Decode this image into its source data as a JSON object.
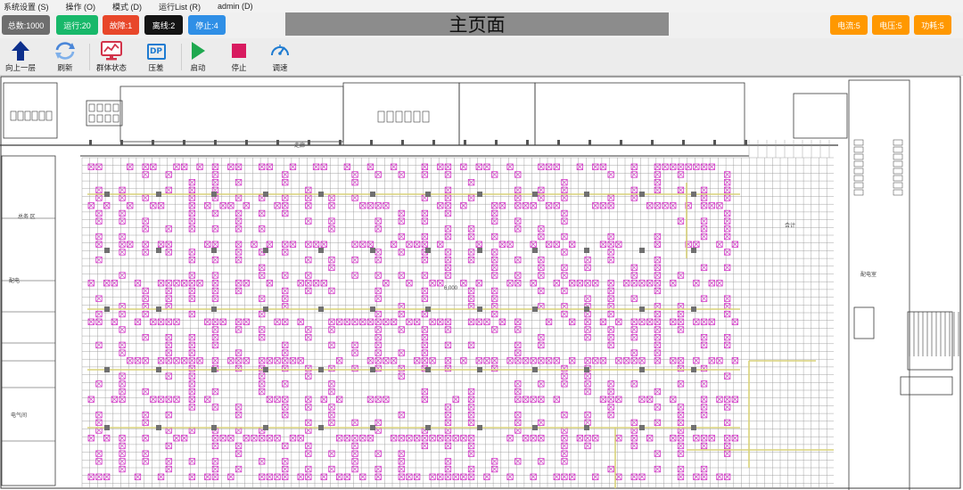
{
  "menu": {
    "items": [
      "系统设置 (S)",
      "操作 (O)",
      "模式 (D)",
      "运行List (R)",
      "admin (D)"
    ]
  },
  "status": {
    "total": "总数:1000",
    "running": "运行:20",
    "fault": "故障:1",
    "offline": "离线:2",
    "stopped": "停止:4",
    "current": "电流:5",
    "voltage": "电压:5",
    "power": "功耗:5"
  },
  "page_title": "主页面",
  "toolbar": {
    "up_level": "向上一层",
    "refresh": "刷新",
    "group_status": "群体状态",
    "pressure_diff": "压差",
    "dp_icon_text": "DP",
    "start": "启动",
    "stop": "停止",
    "speed": "调速"
  },
  "colors": {
    "total": "#6e6e6e",
    "running": "#18b86a",
    "fault": "#e8472a",
    "offline": "#141414",
    "stopped": "#2f8fe6",
    "meter": "#ff9800",
    "title_bg": "#8c8c8c",
    "up_arrow": "#0d2f8c",
    "start_icon": "#1fa84f",
    "stop_icon": "#d81b60",
    "speed_icon": "#1e7bd1",
    "unit_marker": "#d438c8",
    "floor_line": "#9a9a9a",
    "wall_line": "#3a3a3a",
    "duct_line": "#d8d27a"
  },
  "floorplan": {
    "labels": [
      "总务 区",
      "配电",
      "",
      "6,000",
      "走廊",
      "合计",
      "配电室",
      "电气间"
    ]
  }
}
